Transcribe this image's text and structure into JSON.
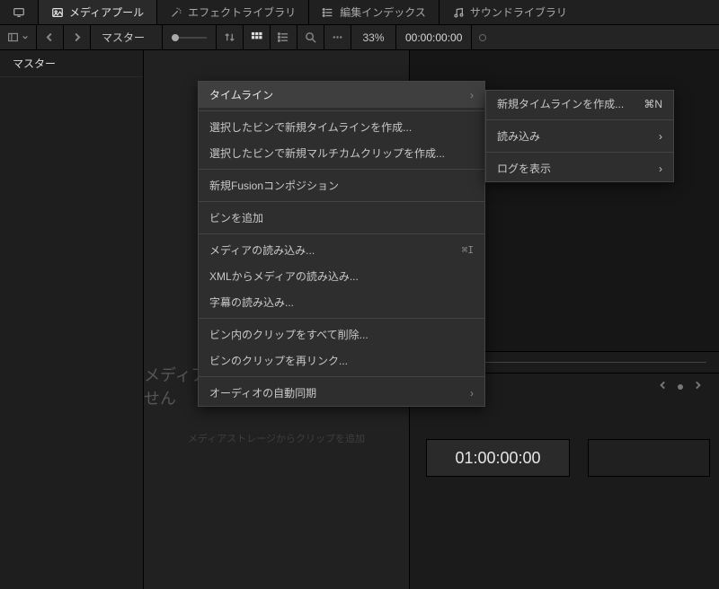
{
  "tabs": {
    "mediaPool": "メディアプール",
    "effects": "エフェクトライブラリ",
    "editIndex": "編集インデックス",
    "sound": "サウンドライブラリ"
  },
  "toolbar": {
    "masterLabel": "マスター",
    "zoomPct": "33%",
    "timecode": "00:00:00:00"
  },
  "sidebar": {
    "master": "マスター"
  },
  "mediaPool": {
    "emptyTitle": "メディアプールにクリップがありません",
    "emptyHint": "メディアストレージからクリップを追加"
  },
  "viewer": {
    "timecode": "01:00:00:00"
  },
  "ctxMenu": {
    "timeline": "タイムライン",
    "newTimelineFromBin": "選択したビンで新規タイムラインを作成...",
    "newMulticamFromBin": "選択したビンで新規マルチカムクリップを作成...",
    "newFusion": "新規Fusionコンポジション",
    "addBin": "ビンを追加",
    "importMedia": "メディアの読み込み...",
    "importMediaShortcut": "⌘I",
    "importXml": "XMLからメディアの読み込み...",
    "importSubs": "字幕の読み込み...",
    "deleteAllInBin": "ビン内のクリップをすべて削除...",
    "relinkBin": "ビンのクリップを再リンク...",
    "audioSync": "オーディオの自動同期"
  },
  "submenu": {
    "createNew": "新規タイムラインを作成...",
    "createNewShortcut": "⌘N",
    "import": "読み込み",
    "showLog": "ログを表示"
  }
}
